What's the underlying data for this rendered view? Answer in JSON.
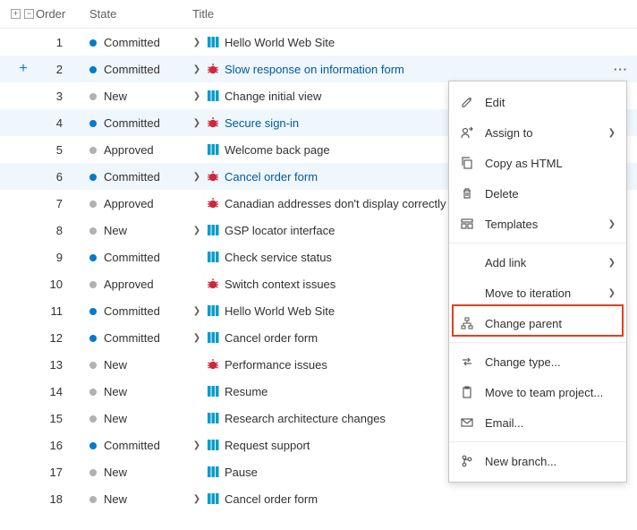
{
  "headers": {
    "order": "Order",
    "state": "State",
    "title": "Title"
  },
  "rows": [
    {
      "order": 1,
      "state": "Committed",
      "stateClass": "dot-committed",
      "type": "pbi",
      "hasChildren": true,
      "title": "Hello World Web Site",
      "selected": false,
      "link": false,
      "ellipsis": false
    },
    {
      "order": 2,
      "state": "Committed",
      "stateClass": "dot-committed",
      "type": "bug",
      "hasChildren": true,
      "title": "Slow response on information form",
      "selected": true,
      "link": true,
      "ellipsis": true,
      "addBtn": true
    },
    {
      "order": 3,
      "state": "New",
      "stateClass": "dot-new",
      "type": "pbi",
      "hasChildren": true,
      "title": "Change initial view",
      "selected": false,
      "link": false,
      "ellipsis": false
    },
    {
      "order": 4,
      "state": "Committed",
      "stateClass": "dot-committed",
      "type": "bug",
      "hasChildren": true,
      "title": "Secure sign-in",
      "selected": true,
      "link": true,
      "ellipsis": true
    },
    {
      "order": 5,
      "state": "Approved",
      "stateClass": "dot-approved",
      "type": "pbi",
      "hasChildren": false,
      "title": "Welcome back page",
      "selected": false,
      "link": false,
      "ellipsis": false
    },
    {
      "order": 6,
      "state": "Committed",
      "stateClass": "dot-committed",
      "type": "bug",
      "hasChildren": true,
      "title": "Cancel order form",
      "selected": true,
      "link": true,
      "ellipsis": true
    },
    {
      "order": 7,
      "state": "Approved",
      "stateClass": "dot-approved",
      "type": "bug",
      "hasChildren": false,
      "title": "Canadian addresses don't display correctly",
      "selected": false,
      "link": false,
      "ellipsis": false
    },
    {
      "order": 8,
      "state": "New",
      "stateClass": "dot-new",
      "type": "pbi",
      "hasChildren": true,
      "title": "GSP locator interface",
      "selected": false,
      "link": false,
      "ellipsis": false
    },
    {
      "order": 9,
      "state": "Committed",
      "stateClass": "dot-committed",
      "type": "pbi",
      "hasChildren": false,
      "title": "Check service status",
      "selected": false,
      "link": false,
      "ellipsis": false
    },
    {
      "order": 10,
      "state": "Approved",
      "stateClass": "dot-approved",
      "type": "bug",
      "hasChildren": false,
      "title": "Switch context issues",
      "selected": false,
      "link": false,
      "ellipsis": false
    },
    {
      "order": 11,
      "state": "Committed",
      "stateClass": "dot-committed",
      "type": "pbi",
      "hasChildren": true,
      "title": "Hello World Web Site",
      "selected": false,
      "link": false,
      "ellipsis": false
    },
    {
      "order": 12,
      "state": "Committed",
      "stateClass": "dot-committed",
      "type": "pbi",
      "hasChildren": true,
      "title": "Cancel order form",
      "selected": false,
      "link": false,
      "ellipsis": false
    },
    {
      "order": 13,
      "state": "New",
      "stateClass": "dot-new",
      "type": "bug",
      "hasChildren": false,
      "title": "Performance issues",
      "selected": false,
      "link": false,
      "ellipsis": false
    },
    {
      "order": 14,
      "state": "New",
      "stateClass": "dot-new",
      "type": "pbi",
      "hasChildren": false,
      "title": "Resume",
      "selected": false,
      "link": false,
      "ellipsis": false
    },
    {
      "order": 15,
      "state": "New",
      "stateClass": "dot-new",
      "type": "pbi",
      "hasChildren": false,
      "title": "Research architecture changes",
      "selected": false,
      "link": false,
      "ellipsis": false
    },
    {
      "order": 16,
      "state": "Committed",
      "stateClass": "dot-committed",
      "type": "pbi",
      "hasChildren": true,
      "title": "Request support",
      "selected": false,
      "link": false,
      "ellipsis": false
    },
    {
      "order": 17,
      "state": "New",
      "stateClass": "dot-new",
      "type": "pbi",
      "hasChildren": false,
      "title": "Pause",
      "selected": false,
      "link": false,
      "ellipsis": false
    },
    {
      "order": 18,
      "state": "New",
      "stateClass": "dot-new",
      "type": "pbi",
      "hasChildren": true,
      "title": "Cancel order form",
      "selected": false,
      "link": false,
      "ellipsis": false
    }
  ],
  "menu": {
    "edit": "Edit",
    "assign_to": "Assign to",
    "copy_html": "Copy as HTML",
    "delete": "Delete",
    "templates": "Templates",
    "add_link": "Add link",
    "move_iteration": "Move to iteration",
    "change_parent": "Change parent",
    "change_type": "Change type...",
    "move_team_project": "Move to team project...",
    "email": "Email...",
    "new_branch": "New branch..."
  }
}
